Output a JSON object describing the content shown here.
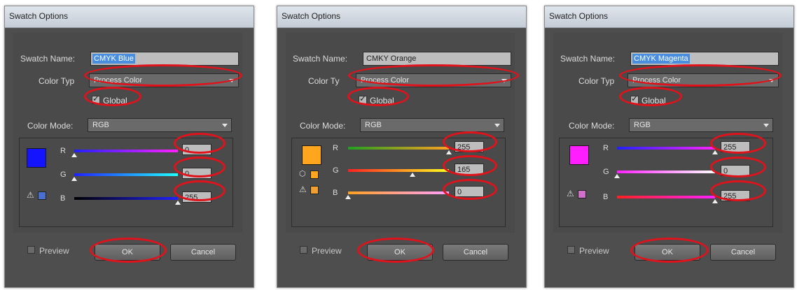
{
  "dialogs": [
    {
      "title": "Swatch Options",
      "swatch_name_label": "Swatch Name:",
      "swatch_name_value": "CMYK Blue",
      "color_type_label": "Color Typ",
      "color_type_value": "Process Color",
      "global_label": "Global",
      "global_checked": true,
      "color_mode_label": "Color Mode:",
      "color_mode_value": "RGB",
      "swatch_color": "#1414ff",
      "channels": [
        {
          "label": "R",
          "value": "0"
        },
        {
          "label": "G",
          "value": "0"
        },
        {
          "label": "B",
          "value": "255"
        }
      ],
      "preview_label": "Preview",
      "ok_label": "OK",
      "cancel_label": "Cancel"
    },
    {
      "title": "Swatch Options",
      "swatch_name_label": "Swatch Name:",
      "swatch_name_value": "CMKY Orange",
      "color_type_label": "Color Ty",
      "color_type_value": "Process Color",
      "global_label": "Global",
      "global_checked": true,
      "color_mode_label": "Color Mode:",
      "color_mode_value": "RGB",
      "swatch_color": "#ffa51e",
      "channels": [
        {
          "label": "R",
          "value": "255"
        },
        {
          "label": "G",
          "value": "165"
        },
        {
          "label": "B",
          "value": "0"
        }
      ],
      "preview_label": "Preview",
      "ok_label": "OK",
      "cancel_label": "Cancel"
    },
    {
      "title": "Swatch Options",
      "swatch_name_label": "Swatch Name:",
      "swatch_name_value": "CMYK Magenta",
      "color_type_label": "Color Typ",
      "color_type_value": "Process Color",
      "global_label": "Global",
      "global_checked": true,
      "color_mode_label": "Color Mode:",
      "color_mode_value": "RGB",
      "swatch_color": "#ff1eff",
      "channels": [
        {
          "label": "R",
          "value": "255"
        },
        {
          "label": "G",
          "value": "0"
        },
        {
          "label": "B",
          "value": "255"
        }
      ],
      "preview_label": "Preview",
      "ok_label": "OK",
      "cancel_label": "Cancel"
    }
  ],
  "highlight_color": "#e0121b"
}
